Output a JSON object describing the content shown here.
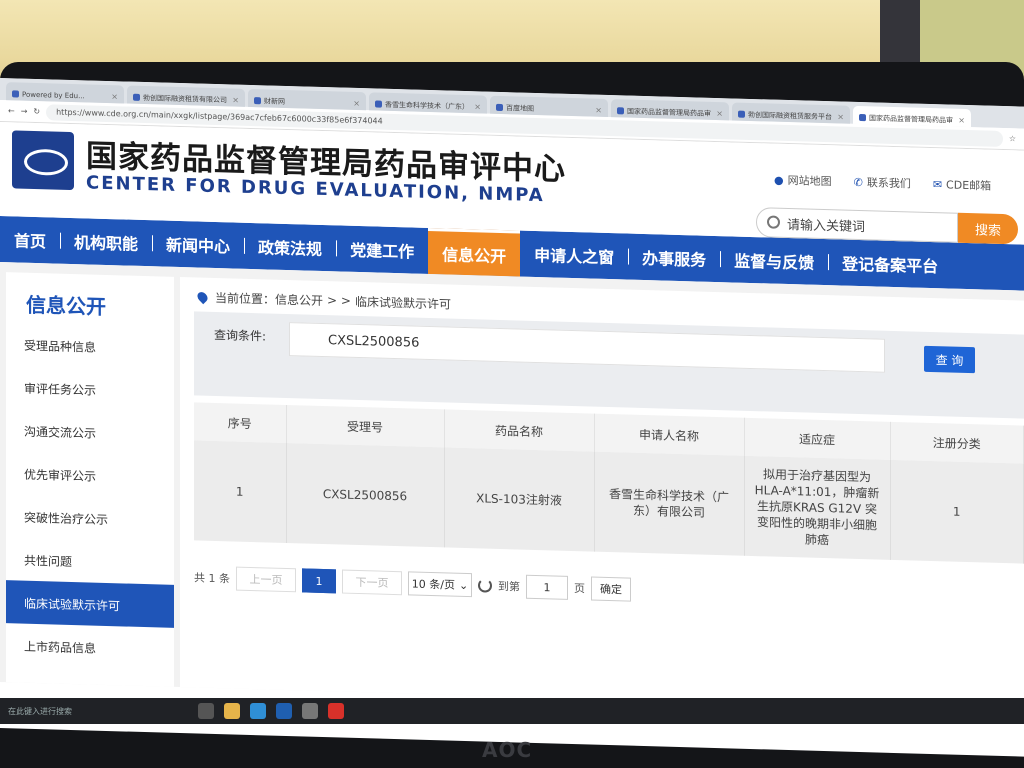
{
  "browser": {
    "tabs": [
      {
        "label": "Powered by Edu..."
      },
      {
        "label": "勃创国际融资租赁有限公司"
      },
      {
        "label": "财新网"
      },
      {
        "label": "香雪生命科学技术（广东）"
      },
      {
        "label": "百度地图"
      },
      {
        "label": "国家药品监督管理局药品审"
      },
      {
        "label": "勃创国际融资租赁服务平台"
      },
      {
        "label": "国家药品监督管理局药品审"
      }
    ],
    "url": "https://www.cde.org.cn/main/xxgk/listpage/369ac7cfeb67c6000c33f85e6f374044"
  },
  "header": {
    "title": "国家药品监督管理局药品审评中心",
    "subtitle": "CENTER FOR DRUG EVALUATION, NMPA",
    "links": [
      {
        "label": "网站地图",
        "icon": "map-pin-icon"
      },
      {
        "label": "联系我们",
        "icon": "phone-icon"
      },
      {
        "label": "CDE邮箱",
        "icon": "mail-icon"
      }
    ],
    "search_placeholder": "请输入关键词",
    "search_button": "搜索"
  },
  "nav": {
    "items": [
      "首页",
      "机构职能",
      "新闻中心",
      "政策法规",
      "党建工作",
      "信息公开",
      "申请人之窗",
      "办事服务",
      "监督与反馈",
      "登记备案平台"
    ],
    "active": "信息公开"
  },
  "sidebar": {
    "title": "信息公开",
    "items": [
      "受理品种信息",
      "审评任务公示",
      "沟通交流公示",
      "优先审评公示",
      "突破性治疗公示",
      "共性问题",
      "临床试验默示许可",
      "上市药品信息"
    ],
    "active": "临床试验默示许可"
  },
  "breadcrumb": {
    "label": "当前位置：信息公开",
    "separator": "> >",
    "current": "临床试验默示许可"
  },
  "query": {
    "label": "查询条件:",
    "value": "CXSL2500856",
    "button": "查 询"
  },
  "table": {
    "headers": [
      "序号",
      "受理号",
      "药品名称",
      "申请人名称",
      "适应症",
      "注册分类"
    ],
    "rows": [
      [
        "1",
        "CXSL2500856",
        "XLS-103注射液",
        "香雪生命科学技术（广东）有限公司",
        "拟用于治疗基因型为HLA-A*11:01，肿瘤新生抗原KRAS G12V 突变阳性的晚期非小细胞肺癌",
        "1"
      ]
    ]
  },
  "pager": {
    "total": "共 1 条",
    "prev": "上一页",
    "current": "1",
    "next": "下一页",
    "page_size": "10 条/页",
    "goto_prefix": "到第",
    "goto_value": "1",
    "goto_suffix": "页",
    "confirm": "确定"
  },
  "taskbar": {
    "search_placeholder": "在此键入进行搜索"
  },
  "monitor": {
    "brand": "AOC"
  }
}
